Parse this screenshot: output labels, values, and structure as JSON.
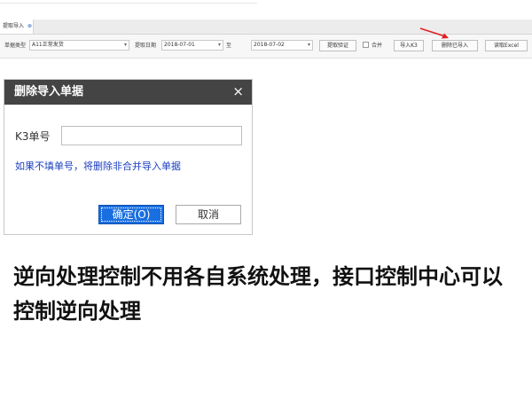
{
  "tabs": [
    {
      "label": "提取导入",
      "close": "⊗"
    }
  ],
  "toolbar": {
    "doc_type_label": "单据类型",
    "doc_type_value": "A11正常发货",
    "date_label": "提取日期",
    "date_from": "2018-07-01",
    "date_to_label": "至",
    "date_to": "2018-07-02",
    "validate_button": "提取验证",
    "merge_label": "合并",
    "import_k3_button": "导入K3",
    "delete_imported_button": "删除已导入",
    "read_excel_button": "读取Excel"
  },
  "dialog": {
    "title": "删除导入单据",
    "close_glyph": "×",
    "field_label": "K3单号",
    "field_value": "",
    "hint": "如果不填单号，将删除非合并导入单据",
    "ok_button": "确定(O)",
    "cancel_button": "取消"
  },
  "caption": "逆向处理控制不用各自系统处理，接口控制中心可以控制逆向处理",
  "colors": {
    "dialog_header": "#444444",
    "ok_button": "#1a6fe0",
    "hint_text": "#1b3fbf",
    "annotation_arrow": "#e02020"
  },
  "icons": {
    "dropdown": "chevron-down-icon",
    "close": "close-icon",
    "annotation": "red-arrow-icon"
  }
}
